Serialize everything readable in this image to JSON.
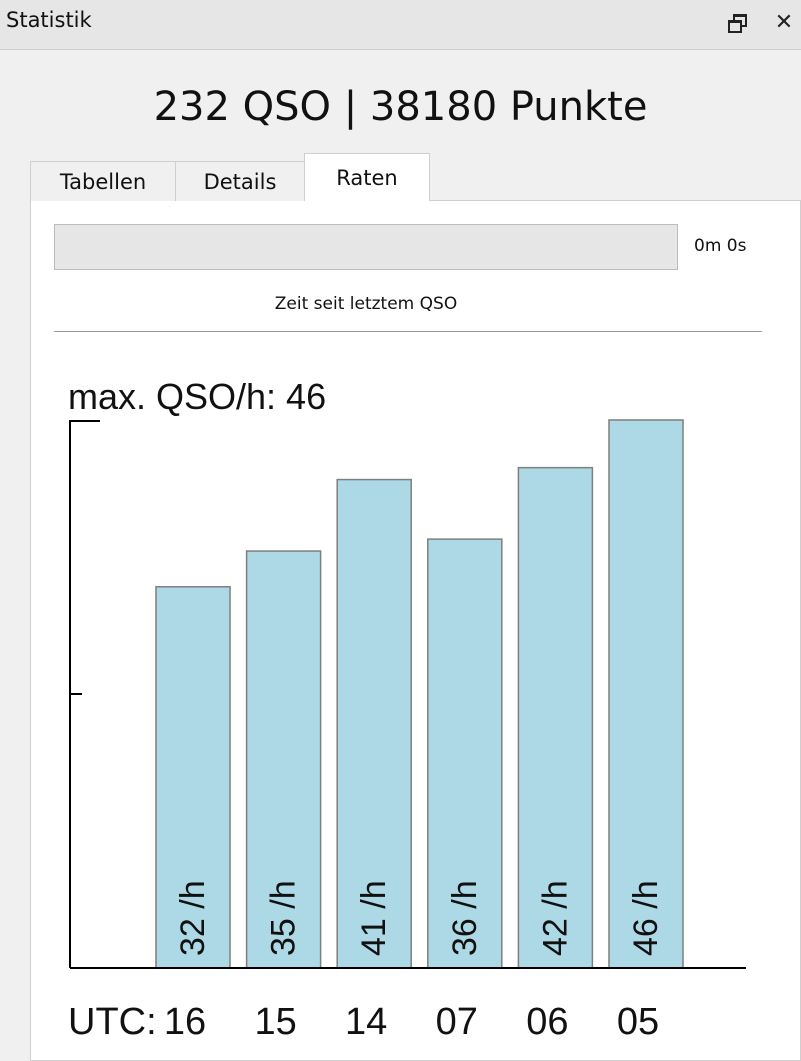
{
  "window": {
    "title": "Statistik",
    "restore_icon": "restore-window-icon",
    "close_icon": "close-icon",
    "close_glyph": "✕"
  },
  "summary": "232 QSO | 38180 Punkte",
  "tabs": [
    {
      "label": "Tabellen",
      "active": false
    },
    {
      "label": "Details",
      "active": false
    },
    {
      "label": "Raten",
      "active": true
    }
  ],
  "timer": {
    "elapsed": "0m 0s",
    "caption": "Zeit seit letztem QSO",
    "progress": 0
  },
  "chart_title": "max. QSO/h: 46",
  "utc_prefix": "UTC:",
  "colors": {
    "bar": "#add8e6",
    "bar_edge": "#7f7f7f",
    "axis": "#000000"
  },
  "chart_data": {
    "type": "bar",
    "categories": [
      "16",
      "15",
      "14",
      "07",
      "06",
      "05"
    ],
    "values": [
      32,
      35,
      41,
      36,
      42,
      46
    ],
    "bar_labels": [
      "32 /h",
      "35 /h",
      "41 /h",
      "36 /h",
      "42 /h",
      "46 /h"
    ],
    "title": "max. QSO/h: 46",
    "xlabel": "UTC:",
    "ylabel": "",
    "ylim": [
      0,
      46
    ],
    "grid": false,
    "legend": "none"
  }
}
